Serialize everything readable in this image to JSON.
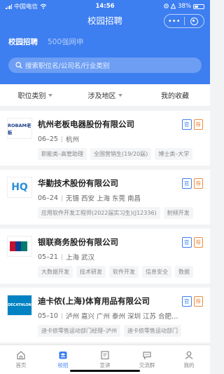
{
  "status": {
    "carrier": "中国电信",
    "time": "14:56",
    "battery": "38%"
  },
  "title": "校园招聘",
  "colors": {
    "brand": "#3d7ef0",
    "official_badge": "#3d7ef0",
    "recommend_badge": "#f08a3d"
  },
  "tabs": [
    {
      "label": "校园招聘",
      "active": true
    },
    {
      "label": "500强网申",
      "active": false
    }
  ],
  "search": {
    "placeholder": "搜索职位名/公司名/行业类别",
    "icon": "search-icon"
  },
  "filters": [
    {
      "label": "职位类别"
    },
    {
      "label": "涉及地区"
    },
    {
      "label": "我的收藏"
    }
  ],
  "companies": [
    {
      "logo_text": "ROBAM老板",
      "logo_color": "#1b3f8b",
      "name": "杭州老板电器股份有限公司",
      "date": "06–25",
      "locations": "杭州",
      "badges": [
        "官",
        "荐"
      ],
      "tags": [
        "职能类–高管助理",
        "全国营销生(19/20届)",
        "博士类–大学"
      ]
    },
    {
      "logo_text": "HQ",
      "logo_color": "#2a8fd8",
      "name": "华勤技术股份有限公司",
      "date": "06–24",
      "locations": "无锡 西安 上海 东莞 南昌",
      "badges": [
        "官",
        "荐"
      ],
      "tags": [
        "应用软件开发工程师(2022届实习生)(J12336)",
        "射频开发"
      ]
    },
    {
      "logo_text": "中国银联",
      "logo_color": "#c8102e",
      "name": "银联商务股份有限公司",
      "date": "05–21",
      "locations": "上海 武汉",
      "badges": [
        "官",
        "荐"
      ],
      "tags": [
        "大数据开发",
        "技术研发",
        "软件开发",
        "信息安全",
        "数据"
      ]
    },
    {
      "logo_text": "DECATHLON",
      "logo_color": "#0082c3",
      "name": "迪卡侬(上海)体育用品有限公司",
      "date": "05–10",
      "locations": "泸州 嘉兴 广州 泰州 深圳 江苏 合肥…",
      "badges": [
        "官",
        "荐"
      ],
      "tags": [
        "迪卡侬零售运动部门经理–泸州",
        "迪卡侬零售运动部门"
      ]
    }
  ],
  "nav": [
    {
      "label": "首页",
      "icon": "home-icon",
      "active": false
    },
    {
      "label": "校招",
      "icon": "campus-icon",
      "active": true
    },
    {
      "label": "宣讲",
      "icon": "presentation-icon",
      "active": false
    },
    {
      "label": "交流群",
      "icon": "chat-icon",
      "active": false
    },
    {
      "label": "我的",
      "icon": "profile-icon",
      "active": false
    }
  ]
}
